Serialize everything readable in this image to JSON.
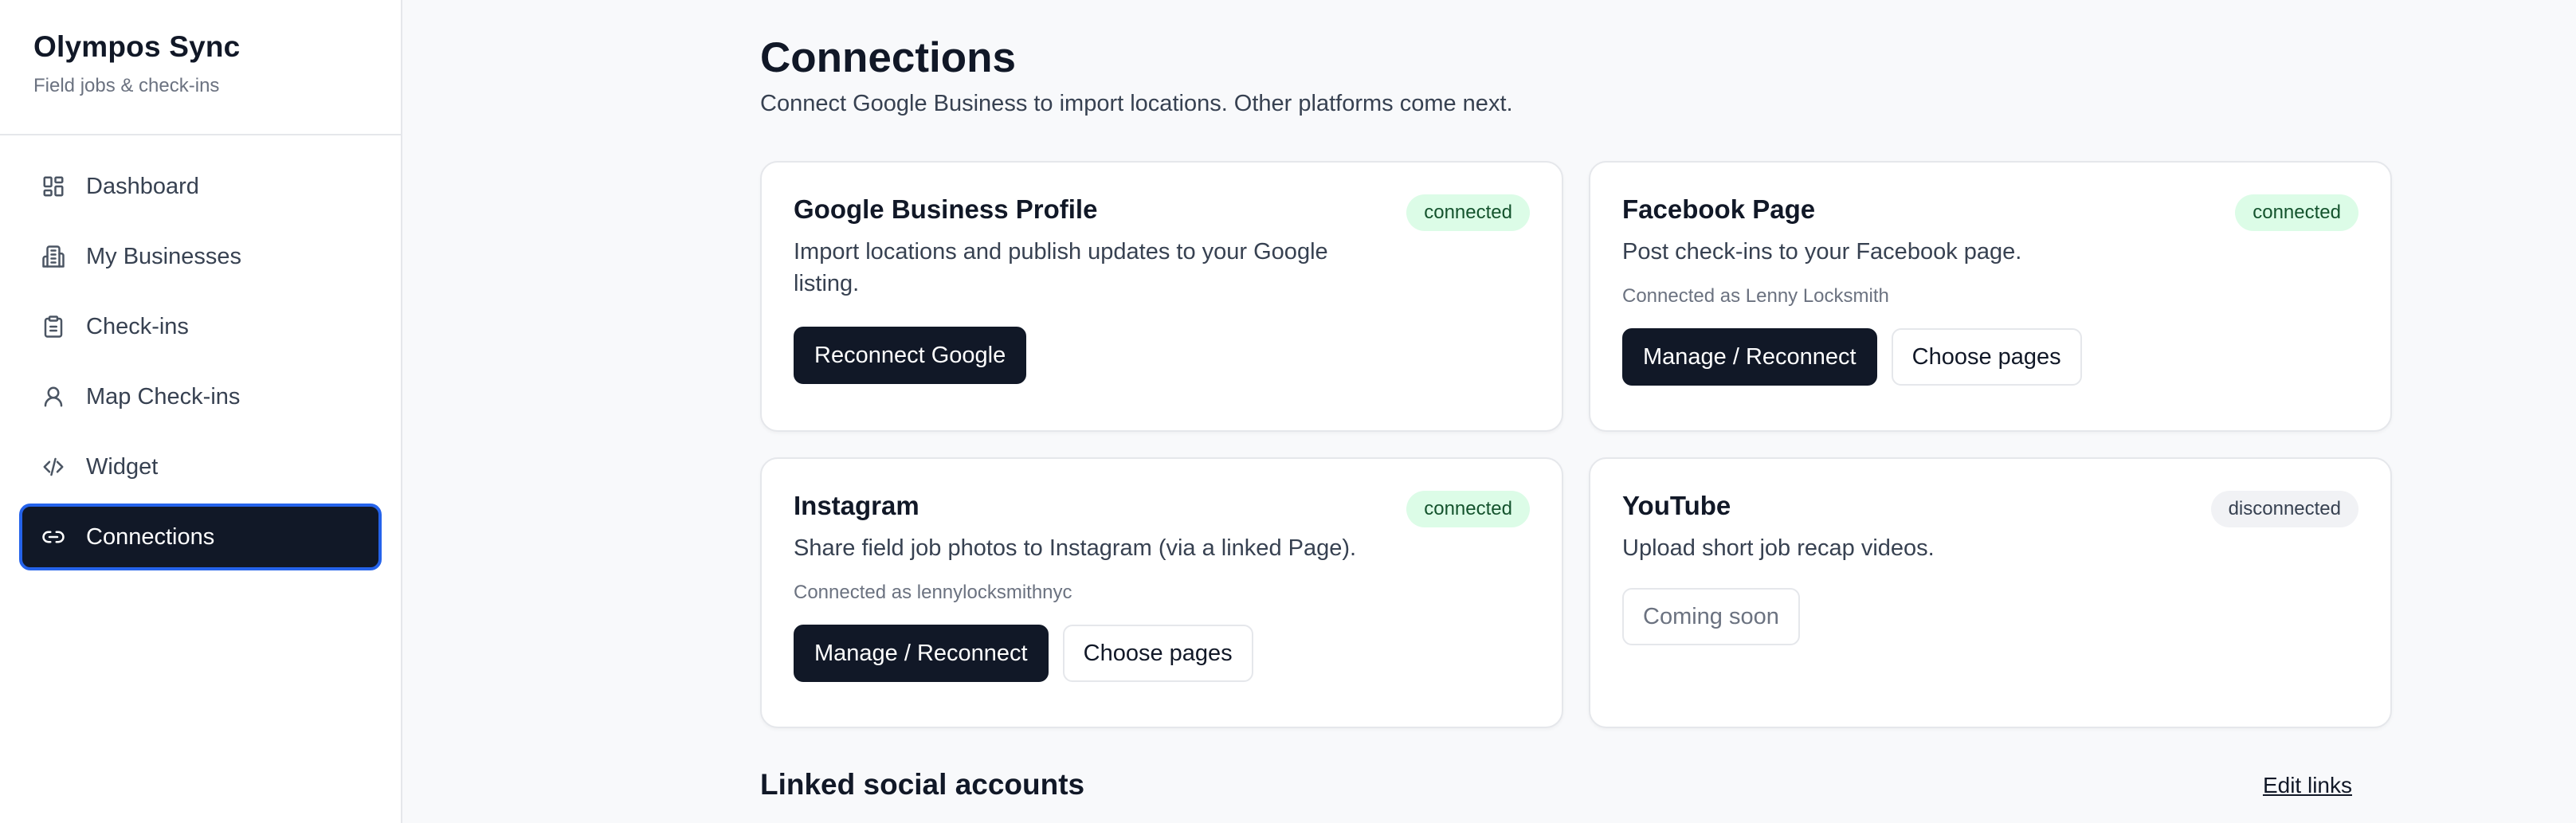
{
  "brand": {
    "title": "Olympos Sync",
    "subtitle": "Field jobs & check-ins"
  },
  "sidebar": {
    "items": [
      {
        "label": "Dashboard",
        "icon": "dashboard-icon"
      },
      {
        "label": "My Businesses",
        "icon": "building-icon"
      },
      {
        "label": "Check-ins",
        "icon": "clipboard-icon"
      },
      {
        "label": "Map Check-ins",
        "icon": "map-pin-icon"
      },
      {
        "label": "Widget",
        "icon": "code-icon"
      },
      {
        "label": "Connections",
        "icon": "link-icon",
        "active": true
      }
    ]
  },
  "page": {
    "title": "Connections",
    "subtitle": "Connect Google Business to import locations. Other platforms come next."
  },
  "cards": {
    "google": {
      "title": "Google Business Profile",
      "status": "connected",
      "description": "Import locations and publish updates to your Google listing.",
      "primary_button": "Reconnect Google"
    },
    "facebook": {
      "title": "Facebook Page",
      "status": "connected",
      "description": "Post check-ins to your Facebook page.",
      "meta": "Connected as Lenny Locksmith",
      "primary_button": "Manage / Reconnect",
      "secondary_button": "Choose pages"
    },
    "instagram": {
      "title": "Instagram",
      "status": "connected",
      "description": "Share field job photos to Instagram (via a linked Page).",
      "meta": "Connected as lennylocksmithnyc",
      "primary_button": "Manage / Reconnect",
      "secondary_button": "Choose pages"
    },
    "youtube": {
      "title": "YouTube",
      "status": "disconnected",
      "description": "Upload short job recap videos.",
      "primary_button": "Coming soon"
    }
  },
  "linked": {
    "title": "Linked social accounts",
    "edit_label": "Edit links"
  },
  "colors": {
    "primary": "#111827",
    "accent_border": "#2563eb",
    "badge_connected_bg": "#dcfce7",
    "badge_disconnected_bg": "#f1f2f5"
  }
}
